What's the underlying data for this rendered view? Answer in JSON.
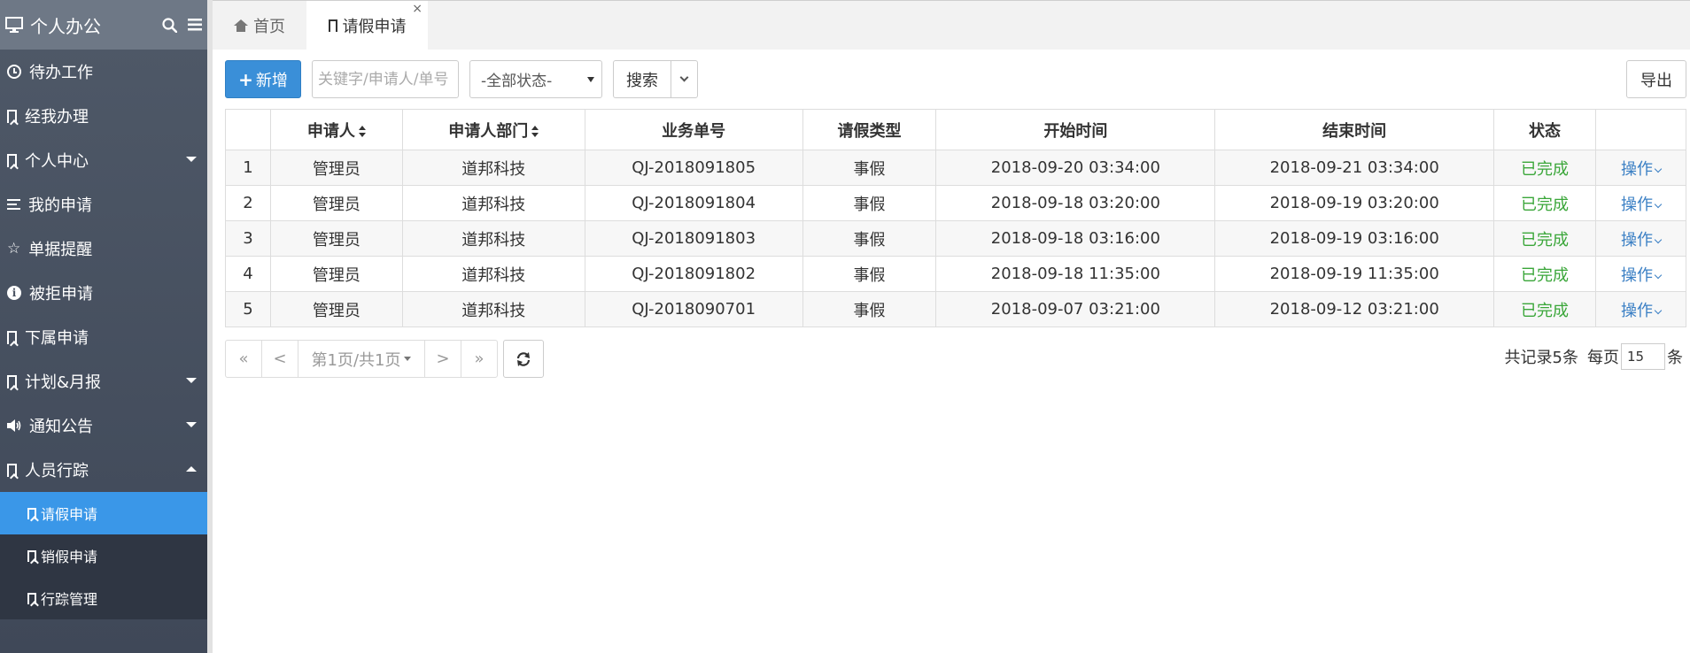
{
  "sidebar": {
    "title": "个人办公",
    "items": [
      {
        "label": "待办工作",
        "icon": "clock-icon"
      },
      {
        "label": "经我办理",
        "icon": "bookmark-icon"
      },
      {
        "label": "个人中心",
        "icon": "bookmark-icon",
        "expandable": true
      },
      {
        "label": "我的申请",
        "icon": "list-icon"
      },
      {
        "label": "单据提醒",
        "icon": "star-icon"
      },
      {
        "label": "被拒申请",
        "icon": "info-icon"
      },
      {
        "label": "下属申请",
        "icon": "bookmark-icon"
      },
      {
        "label": "计划&月报",
        "icon": "bookmark-icon",
        "expandable": true
      },
      {
        "label": "通知公告",
        "icon": "volume-icon",
        "expandable": true
      },
      {
        "label": "人员行踪",
        "icon": "bookmark-icon",
        "expanded": true
      }
    ],
    "subitems": [
      {
        "label": "请假申请",
        "active": true
      },
      {
        "label": "销假申请"
      },
      {
        "label": "行踪管理"
      }
    ]
  },
  "tabs": {
    "home": "首页",
    "active": "请假申请",
    "close": "×"
  },
  "toolbar": {
    "add_label": "新增",
    "search_placeholder": "关键字/申请人/单号",
    "status_select": "-全部状态-",
    "search_label": "搜索",
    "export_label": "导出"
  },
  "table": {
    "headers": [
      "",
      "申请人",
      "申请人部门",
      "业务单号",
      "请假类型",
      "开始时间",
      "结束时间",
      "状态",
      ""
    ],
    "rows": [
      {
        "no": "1",
        "applicant": "管理员",
        "dept": "道邦科技",
        "code": "QJ-2018091805",
        "type": "事假",
        "start": "2018-09-20 03:34:00",
        "end": "2018-09-21 03:34:00",
        "status": "已完成",
        "op": "操作"
      },
      {
        "no": "2",
        "applicant": "管理员",
        "dept": "道邦科技",
        "code": "QJ-2018091804",
        "type": "事假",
        "start": "2018-09-18 03:20:00",
        "end": "2018-09-19 03:20:00",
        "status": "已完成",
        "op": "操作"
      },
      {
        "no": "3",
        "applicant": "管理员",
        "dept": "道邦科技",
        "code": "QJ-2018091803",
        "type": "事假",
        "start": "2018-09-18 03:16:00",
        "end": "2018-09-19 03:16:00",
        "status": "已完成",
        "op": "操作"
      },
      {
        "no": "4",
        "applicant": "管理员",
        "dept": "道邦科技",
        "code": "QJ-2018091802",
        "type": "事假",
        "start": "2018-09-18 11:35:00",
        "end": "2018-09-19 11:35:00",
        "status": "已完成",
        "op": "操作"
      },
      {
        "no": "5",
        "applicant": "管理员",
        "dept": "道邦科技",
        "code": "QJ-2018090701",
        "type": "事假",
        "start": "2018-09-07 03:21:00",
        "end": "2018-09-12 03:21:00",
        "status": "已完成",
        "op": "操作"
      }
    ]
  },
  "pager": {
    "first": "«",
    "prev": "<",
    "page_info": "第1页/共1页",
    "next": ">",
    "last": "»",
    "total": "共记录5条",
    "per_page_label": "每页",
    "per_page_value": "15",
    "per_page_unit": "条"
  },
  "colors": {
    "sidebar_bg": "#4f5968",
    "active_item": "#3a97e8",
    "primary_button": "#3a8fd8",
    "status_done": "#3aa639",
    "link": "#3a7fc4"
  }
}
